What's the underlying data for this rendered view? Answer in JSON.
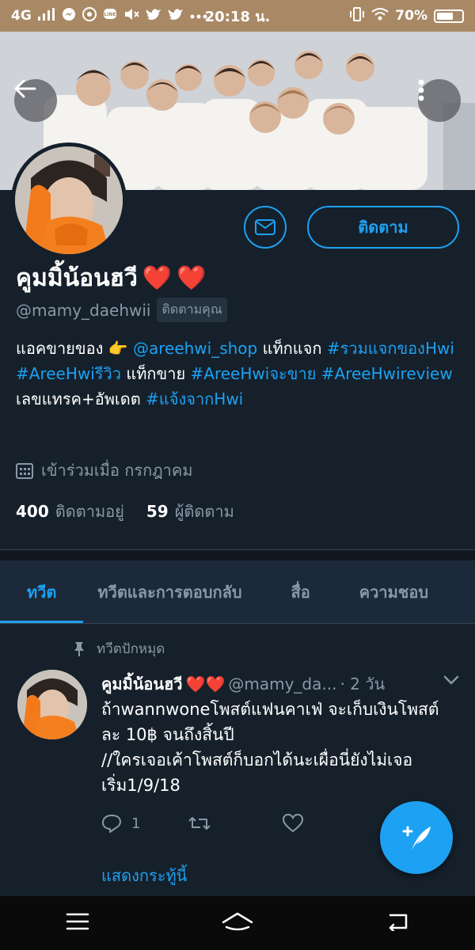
{
  "status_bar": {
    "network": "4G",
    "time": "20:18 น.",
    "battery": "70%",
    "battery_level": 0.7,
    "icons": [
      "signal-icon",
      "messenger-icon",
      "chrome-icon",
      "line-icon",
      "mute-icon",
      "twitter-icon",
      "more-dots-icon",
      "vibrate-icon",
      "wifi-icon"
    ]
  },
  "profile": {
    "name": "คูมมิ้น้อนฮวี",
    "handle": "@mamy_daehwii",
    "follows_you": "ติดตามคุณ",
    "follow_label": "ติดตาม",
    "bio": [
      {
        "text": "แอคขายของ 👉 ",
        "link": false
      },
      {
        "text": "@areehwi_shop",
        "link": true
      },
      {
        "text": "  แท็กแจก ",
        "link": false
      },
      {
        "text": "#รวมแจกของHwi",
        "link": true
      },
      {
        "text": " ",
        "link": false
      },
      {
        "text": "#AreeHwiรีวิว",
        "link": true
      },
      {
        "text": " แท็กขาย ",
        "link": false
      },
      {
        "text": "#AreeHwiจะขาย",
        "link": true
      },
      {
        "text": " ",
        "link": false
      },
      {
        "text": "#AreeHwireview",
        "link": true
      },
      {
        "text": "  เลขแทรค+อัพเดต ",
        "link": false
      },
      {
        "text": "#แจ้งจากHwi",
        "link": true
      }
    ],
    "joined": "เข้าร่วมเมื่อ กรกฎาคม",
    "following_count": "400",
    "following_label": "ติดตามอยู่",
    "followers_count": "59",
    "followers_label": "ผู้ติดตาม"
  },
  "tabs": [
    "ทวีต",
    "ทวีตและการตอบกลับ",
    "สื่อ",
    "ความชอบ"
  ],
  "tweet": {
    "pinned_label": "ทวีตปักหมุด",
    "name": "คูมมิ้น้อนฮวี",
    "handle": "@mamy_da...",
    "time": "· 2 วัน",
    "text": "ถ้าwannwoneโพสต์แฟนคาเฟ่ จะเก็บเงินโพสต์ละ 10฿ จนถึงสิ้นปี\n//ใครเจอเค้าโพสต์ก็บอกได้นะเผื่อนี่ยังไม่เจอ เริ่ม1/9/18",
    "reply_count": "1",
    "show_thread": "แสดงกระทู้นี้"
  },
  "colors": {
    "background": "#15202b",
    "accent": "#1da1f2",
    "muted": "#8899a6",
    "heart": "#e0245e",
    "status_bar": "#a98965"
  }
}
